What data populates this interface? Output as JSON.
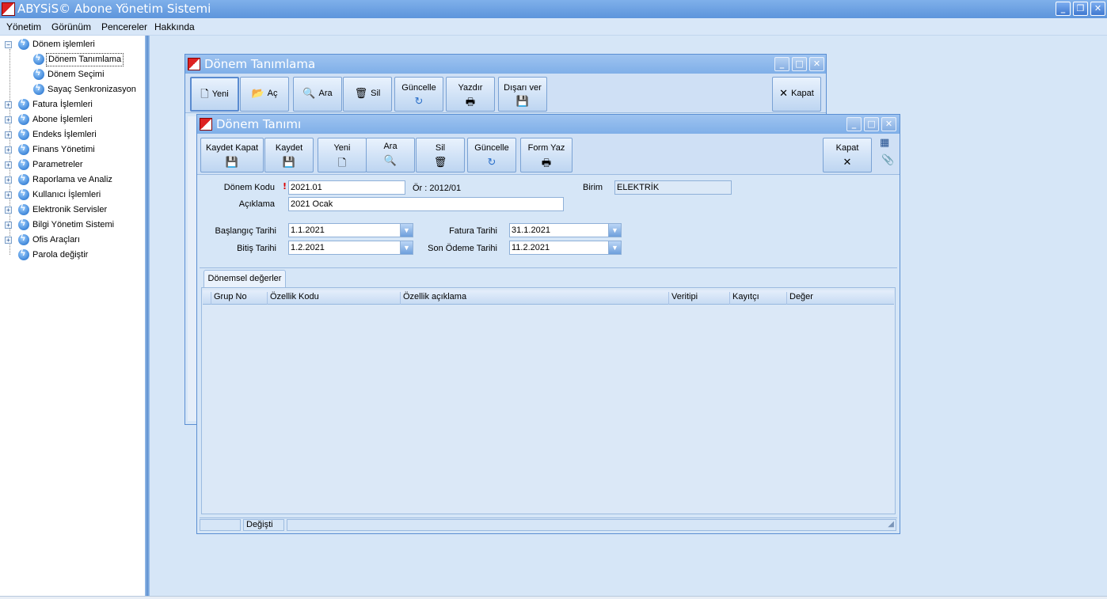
{
  "app": {
    "title": "ABYSiS© Abone Yönetim Sistemi"
  },
  "menu": [
    "Yönetim",
    "Görünüm",
    "Pencereler",
    "Hakkında"
  ],
  "sidebar": {
    "items": [
      {
        "label": "Dönem işlemleri",
        "expanded": true
      },
      {
        "label": "Dönem Tanımlama",
        "child": true,
        "selected": true
      },
      {
        "label": "Dönem Seçimi",
        "child": true
      },
      {
        "label": "Sayaç Senkronizasyon",
        "child": true
      },
      {
        "label": "Fatura İşlemleri"
      },
      {
        "label": "Abone İşlemleri"
      },
      {
        "label": "Endeks İşlemleri"
      },
      {
        "label": "Finans Yönetimi"
      },
      {
        "label": "Parametreler"
      },
      {
        "label": "Raporlama ve Analiz"
      },
      {
        "label": "Kullanıcı İşlemleri"
      },
      {
        "label": "Elektronik Servisler"
      },
      {
        "label": "Bilgi Yönetim Sistemi"
      },
      {
        "label": "Ofis Araçları"
      },
      {
        "label": "Parola değiştir",
        "leaf": true
      }
    ]
  },
  "back_window": {
    "title": "Dönem Tanımlama",
    "toolbar": {
      "yeni": "Yeni",
      "ac": "Aç",
      "ara": "Ara",
      "sil": "Sil",
      "guncelle": "Güncelle",
      "yazdir": "Yazdır",
      "disari_ver": "Dışarı ver",
      "kapat": "Kapat"
    }
  },
  "front_window": {
    "title": "Dönem Tanımı",
    "toolbar": {
      "kaydet_kapat": "Kaydet Kapat",
      "kaydet": "Kaydet",
      "yeni": "Yeni",
      "ara": "Ara",
      "sil": "Sil",
      "guncelle": "Güncelle",
      "form_yaz": "Form Yaz",
      "kapat": "Kapat"
    },
    "form": {
      "donem_kodu_label": "Dönem Kodu",
      "required_mark": "!",
      "donem_kodu": "2021.01",
      "ornek": "Ör : 2012/01",
      "birim_label": "Birim",
      "birim": "ELEKTRİK",
      "aciklama_label": "Açıklama",
      "aciklama": "2021 Ocak",
      "baslangic_label": "Başlangıç Tarihi",
      "baslangic": "1.1.2021",
      "bitis_label": "Bitiş Tarihi",
      "bitis": "1.2.2021",
      "fatura_label": "Fatura Tarihi",
      "fatura": "31.1.2021",
      "son_odeme_label": "Son Ödeme Tarihi",
      "son_odeme": "11.2.2021"
    },
    "tab": "Dönemsel değerler",
    "grid_columns": [
      "Grup No",
      "Özellik Kodu",
      "Özellik açıklama",
      "Veritipi",
      "Kayıtçı",
      "Değer"
    ],
    "status": {
      "cell1": "",
      "state": "Değişti"
    }
  }
}
